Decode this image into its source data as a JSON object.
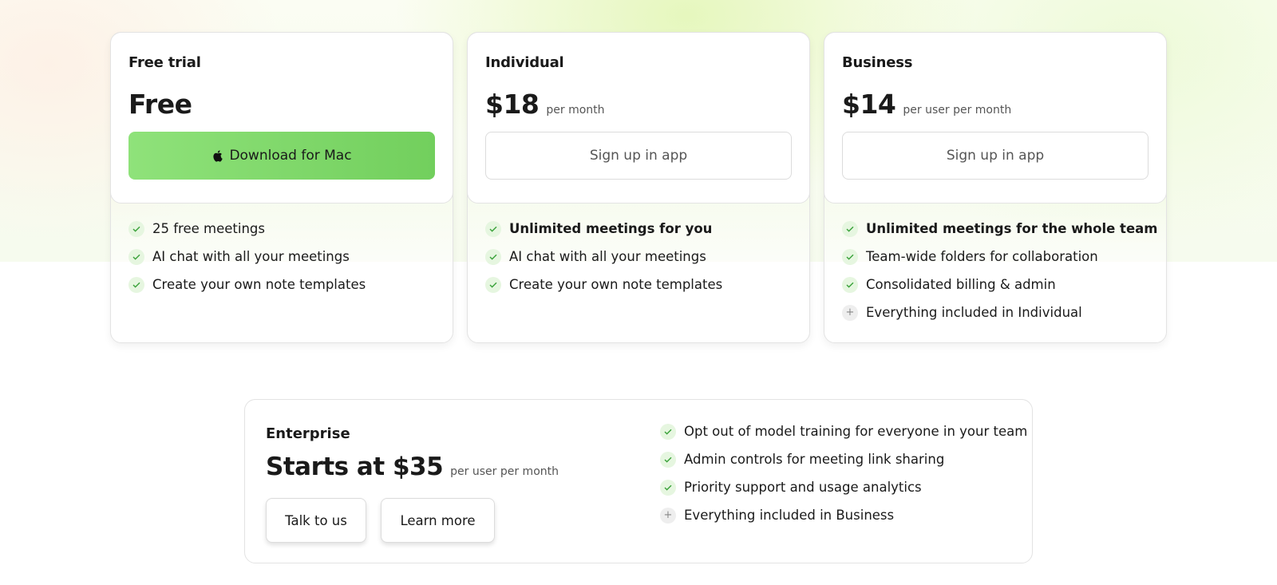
{
  "plans": [
    {
      "name": "Free trial",
      "price": "Free",
      "price_unit": "",
      "button_label": "Download for Mac",
      "button_style": "primary",
      "features": [
        {
          "text": "25 free meetings",
          "icon": "check-icon",
          "bold": false
        },
        {
          "text": "AI chat with all your meetings",
          "icon": "check-icon",
          "bold": false
        },
        {
          "text": "Create your own note templates",
          "icon": "check-icon",
          "bold": false
        }
      ]
    },
    {
      "name": "Individual",
      "price": "$18",
      "price_unit": "per month",
      "button_label": "Sign up in app",
      "button_style": "outline",
      "features": [
        {
          "text": "Unlimited meetings for you",
          "icon": "check-icon",
          "bold": true
        },
        {
          "text": "AI chat with all your meetings",
          "icon": "check-icon",
          "bold": false
        },
        {
          "text": "Create your own note templates",
          "icon": "check-icon",
          "bold": false
        }
      ]
    },
    {
      "name": "Business",
      "price": "$14",
      "price_unit": "per user per month",
      "button_label": "Sign up in app",
      "button_style": "outline",
      "features": [
        {
          "text": "Unlimited meetings for the whole team",
          "icon": "check-icon",
          "bold": true
        },
        {
          "text": "Team-wide folders for collaboration",
          "icon": "check-icon",
          "bold": false
        },
        {
          "text": "Consolidated billing & admin",
          "icon": "check-icon",
          "bold": false
        },
        {
          "text": "Everything included in Individual",
          "icon": "plus-icon",
          "bold": false
        }
      ]
    }
  ],
  "enterprise": {
    "name": "Enterprise",
    "price": "Starts at $35",
    "price_unit": "per user per month",
    "buttons": [
      "Talk to us",
      "Learn more"
    ],
    "features": [
      {
        "text": "Opt out of model training for everyone in your team",
        "icon": "check-icon"
      },
      {
        "text": "Admin controls for meeting link sharing",
        "icon": "check-icon"
      },
      {
        "text": "Priority support and usage analytics",
        "icon": "check-icon"
      },
      {
        "text": "Everything included in Business",
        "icon": "plus-icon"
      }
    ]
  },
  "colors": {
    "accent_green": "#7fd96a",
    "check_green": "#3aa23a",
    "border": "#e3e3e3",
    "text": "#1a1a1a",
    "muted": "#555555"
  }
}
